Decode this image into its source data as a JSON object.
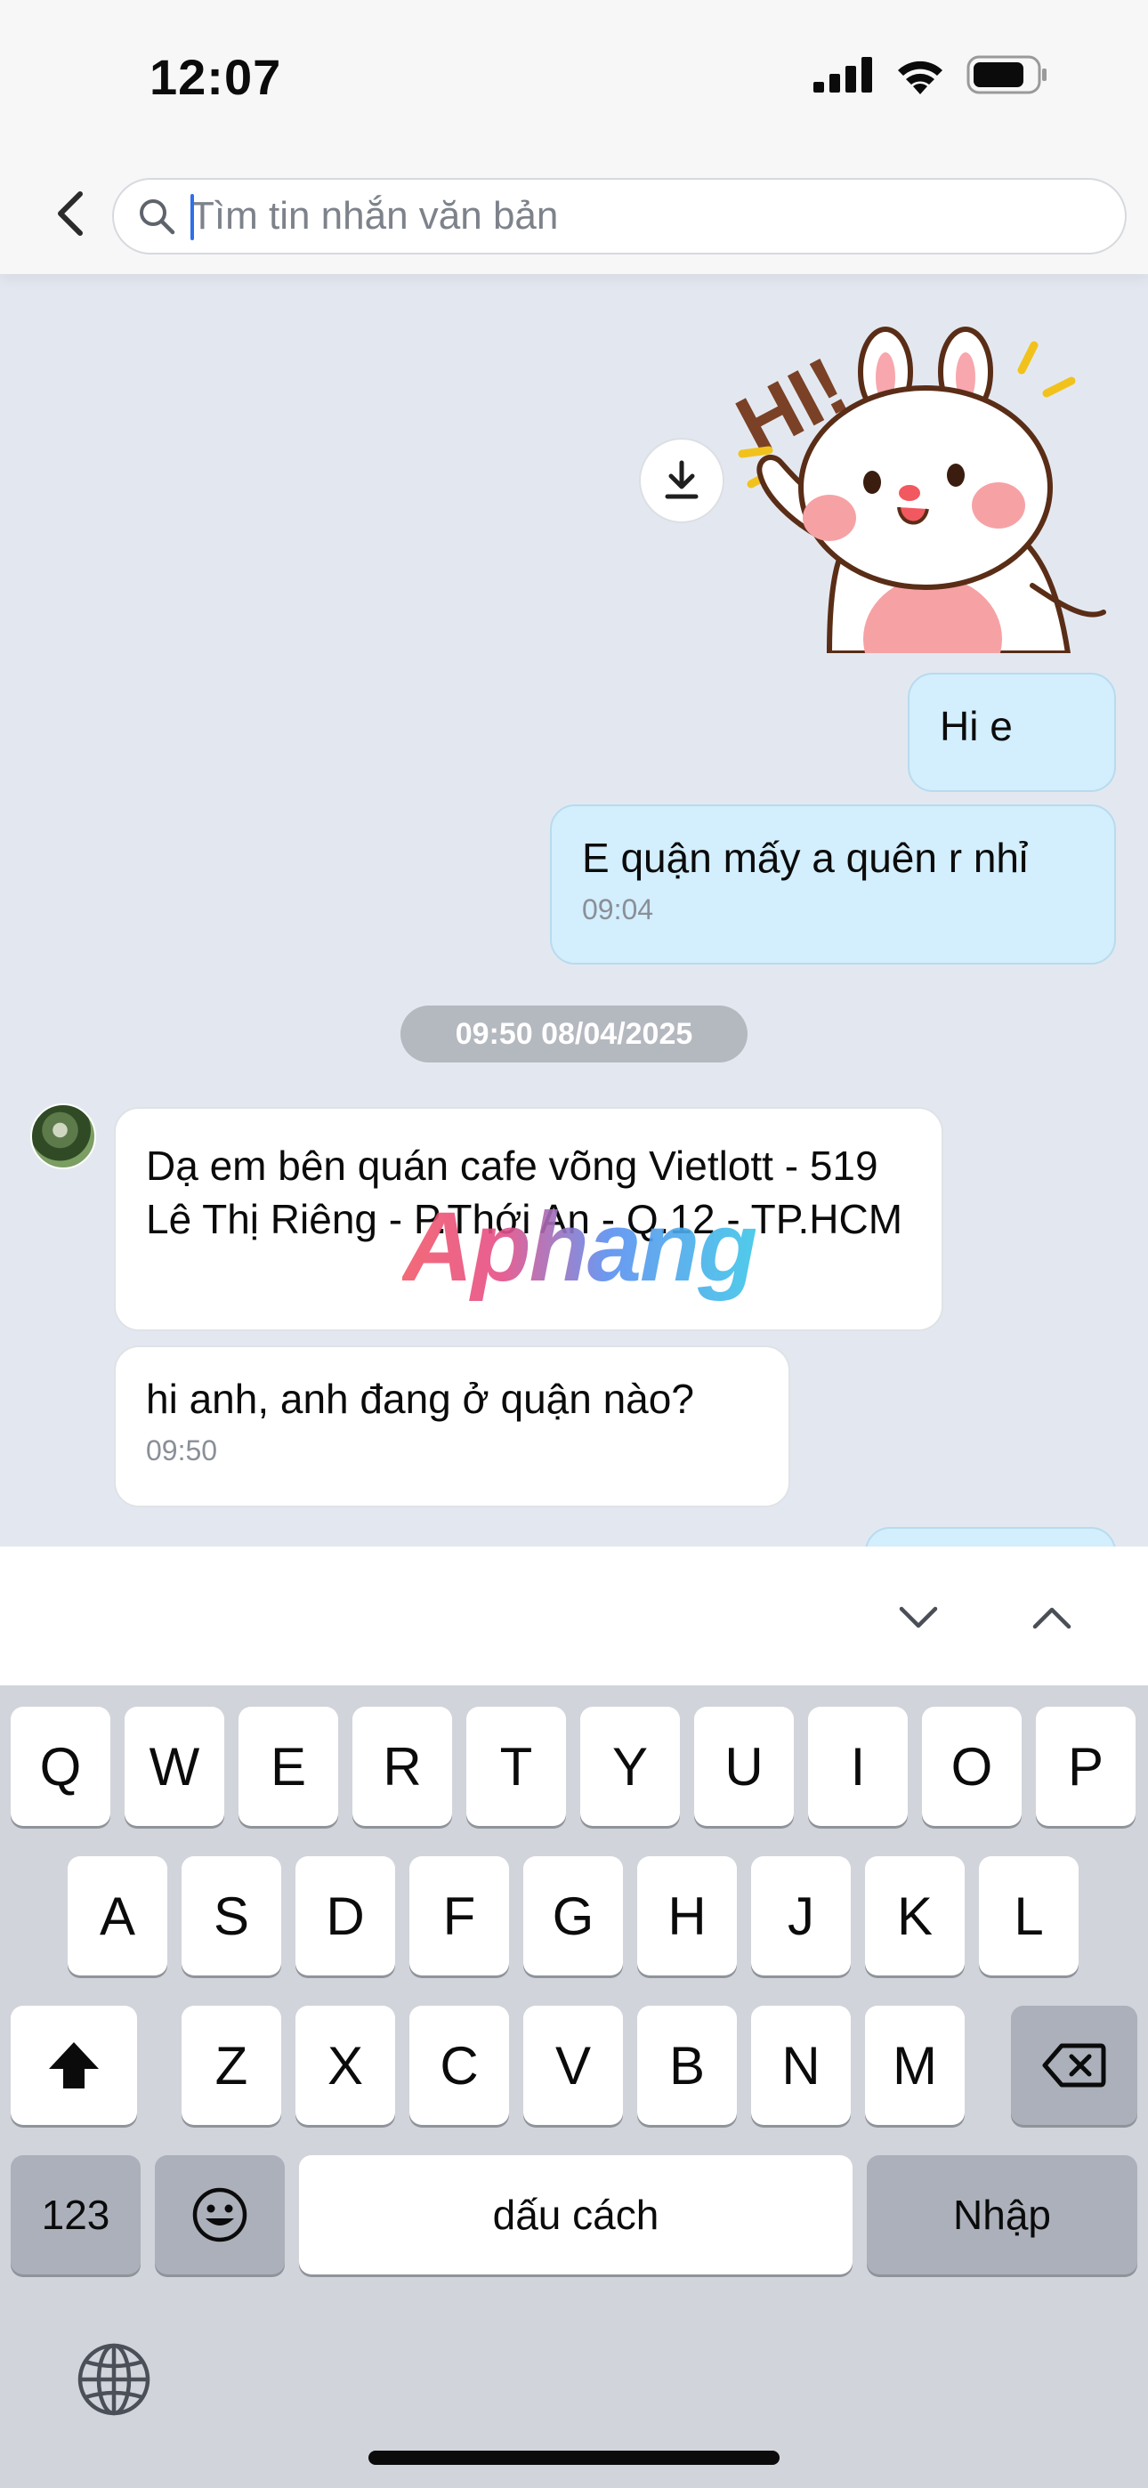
{
  "status_bar": {
    "time": "12:07"
  },
  "search": {
    "placeholder": "Tìm tin nhắn văn bản",
    "value": ""
  },
  "messages": {
    "outgoing_1": "Hi e",
    "outgoing_2": {
      "text": "E quận mấy a quên r nhỉ",
      "time": "09:04"
    },
    "date_divider": "09:50 08/04/2025",
    "incoming_1": "Dạ em bên quán cafe võng Vietlott - 519 Lê Thị Riêng - P.Thới An - Q.12 - TP.HCM",
    "incoming_2": {
      "text": "hi anh, anh đang ở quận nào?",
      "time": "09:50"
    }
  },
  "sticker": {
    "text": "HI!"
  },
  "watermark": "Aphang",
  "keyboard": {
    "row1": [
      "Q",
      "W",
      "E",
      "R",
      "T",
      "Y",
      "U",
      "I",
      "O",
      "P"
    ],
    "row2": [
      "A",
      "S",
      "D",
      "F",
      "G",
      "H",
      "J",
      "K",
      "L"
    ],
    "row3": [
      "Z",
      "X",
      "C",
      "V",
      "B",
      "N",
      "M"
    ],
    "numbers_label": "123",
    "space_label": "dấu cách",
    "return_label": "Nhập"
  },
  "icons": {
    "back": "chevron-left-icon",
    "search": "search-icon",
    "download": "download-icon",
    "nav_down": "chevron-down-icon",
    "nav_up": "chevron-up-icon",
    "shift": "shift-icon",
    "delete": "backspace-icon",
    "emoji": "emoji-icon",
    "globe": "globe-icon"
  },
  "colors": {
    "outgoing_bubble": "#d3eefc",
    "incoming_bubble": "#ffffff",
    "chat_background": "#e3e8f0",
    "caret": "#2f6fe8"
  }
}
